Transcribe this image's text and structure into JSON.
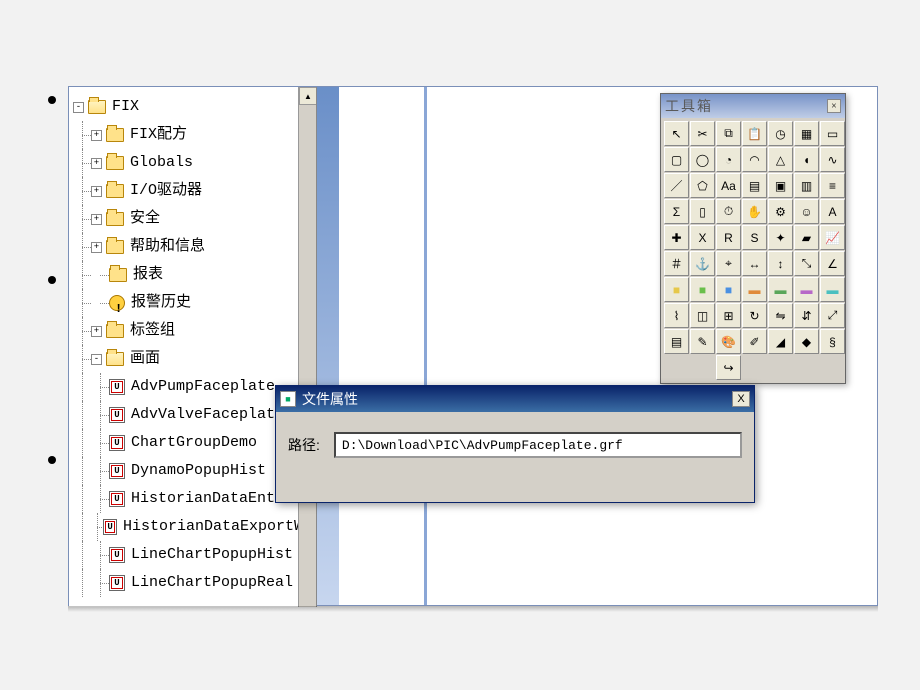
{
  "bullets": [
    "",
    "",
    ""
  ],
  "tree": {
    "root": "FIX",
    "items": [
      {
        "label": "FIX配方",
        "exp": "+"
      },
      {
        "label": "Globals",
        "exp": "+"
      },
      {
        "label": "I/O驱动器",
        "exp": "+"
      },
      {
        "label": "安全",
        "exp": "+"
      },
      {
        "label": "帮助和信息",
        "exp": "+"
      },
      {
        "label": "报表",
        "exp": ""
      },
      {
        "label": "报警历史",
        "exp": "",
        "icon": "warn"
      },
      {
        "label": "标签组",
        "exp": "+"
      },
      {
        "label": "画面",
        "exp": "-"
      }
    ],
    "pics": [
      "AdvPumpFaceplate",
      "AdvValveFaceplate",
      "ChartGroupDemo",
      "DynamoPopupHist",
      "HistorianDataEntr",
      "HistorianDataExportWi",
      "LineChartPopupHist",
      "LineChartPopupReal"
    ]
  },
  "toolbox": {
    "title": "工具箱",
    "rows": 11,
    "tools": [
      "pointer",
      "cut",
      "copy",
      "paste",
      "clock",
      "grid",
      "rect-tool",
      "rrect",
      "circle",
      "pie",
      "arc",
      "tri",
      "chord",
      "curve",
      "line",
      "poly",
      "text-aa",
      "table",
      "layers",
      "layers2",
      "db",
      "sigma",
      "clipboard",
      "stopwatch",
      "hand",
      "gear",
      "face",
      "font",
      "cross",
      "x-var",
      "r-var",
      "s-var",
      "sparkle",
      "stamp",
      "chart",
      "hash",
      "anchor",
      "snap",
      "dim-h",
      "dim-v",
      "dim-d",
      "dim-a",
      "sq-y",
      "sq-g",
      "sq-b",
      "rect-o",
      "rect-g",
      "rect-p",
      "rect-c",
      "cyl",
      "box3d",
      "prop",
      "refresh",
      "mirror",
      "flip",
      "scale",
      "sheet",
      "note",
      "palette",
      "pen",
      "brush",
      "shape",
      "script",
      "blank",
      "blank",
      "redo",
      "blank",
      "blank",
      "blank",
      "blank"
    ]
  },
  "dialog": {
    "title": "文件属性",
    "path_label": "路径:",
    "path_value": "D:\\Download\\PIC\\AdvPumpFaceplate.grf",
    "close": "X"
  }
}
